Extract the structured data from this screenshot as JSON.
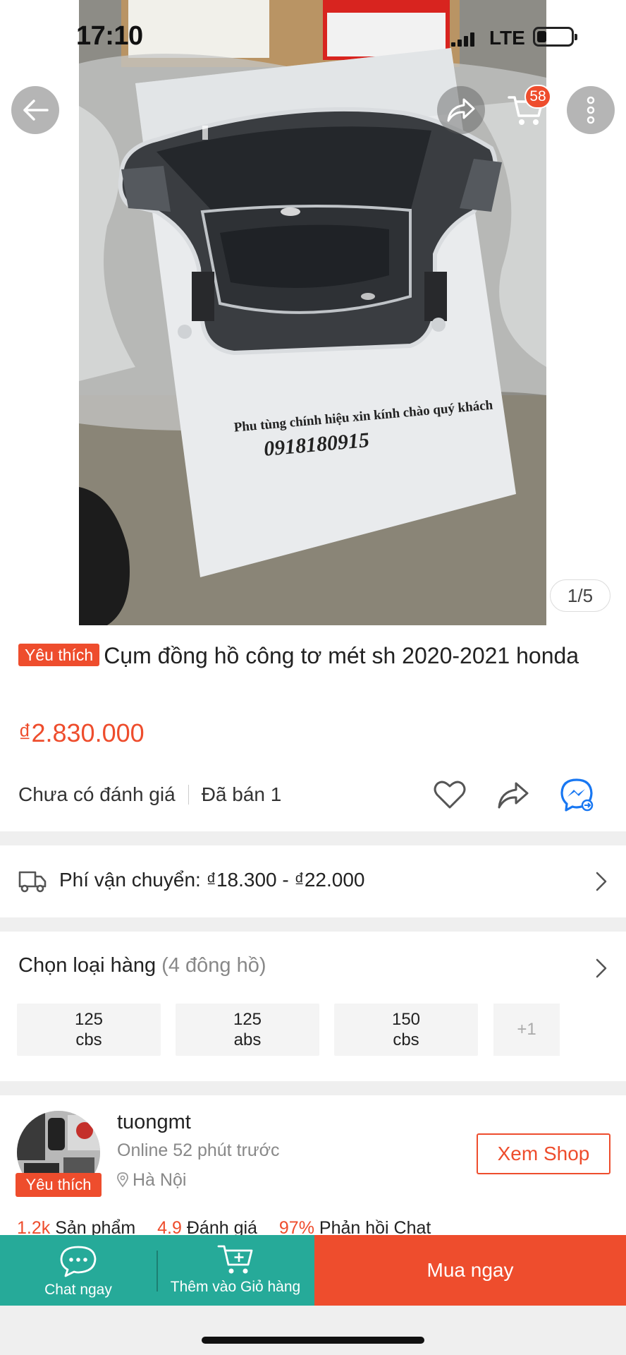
{
  "status_bar": {
    "time": "17:10",
    "network": "LTE"
  },
  "top_nav": {
    "back_icon": "arrow-left-icon",
    "share_icon": "share-arrow-icon",
    "cart_icon": "cart-icon",
    "cart_badge": "58",
    "more_icon": "more-vertical-icon"
  },
  "product_image": {
    "counter": "1/5",
    "photo_text_line1": "Phu tùng chính hiệu xin kính chào quý khách",
    "photo_text_line2": "0918180915"
  },
  "product": {
    "badge": "Yêu thích",
    "title": "Cụm đồng hồ công tơ mét sh 2020-2021 honda",
    "price": "₫2.830.000",
    "rating_text": "Chưa có đánh giá",
    "sold_text": "Đã bán 1"
  },
  "shipping": {
    "text": "Phí vận chuyển: ₫18.300 - ₫22.000"
  },
  "variants": {
    "label": "Chọn loại hàng",
    "count": "(4 đông hồ)",
    "options": [
      {
        "line1": "125",
        "line2": "cbs"
      },
      {
        "line1": "125",
        "line2": "abs"
      },
      {
        "line1": "150",
        "line2": "cbs"
      }
    ],
    "more": "+1"
  },
  "shop": {
    "name": "tuongmt",
    "badge": "Yêu thích",
    "online": "Online 52 phút trước",
    "location": "Hà Nội",
    "view_button": "Xem Shop",
    "stats": {
      "products_num": "1.2k",
      "products_label": "Sản phẩm",
      "rating_num": "4.9",
      "rating_label": "Đánh giá",
      "chat_num": "97%",
      "chat_label": "Phản hồi Chat"
    }
  },
  "bottom_bar": {
    "chat_label": "Chat ngay",
    "add_cart_label": "Thêm vào Giỏ hàng",
    "buy_label": "Mua ngay"
  },
  "colors": {
    "accent": "#ee4d2d",
    "teal": "#26aa99",
    "messenger": "#1877f2"
  }
}
